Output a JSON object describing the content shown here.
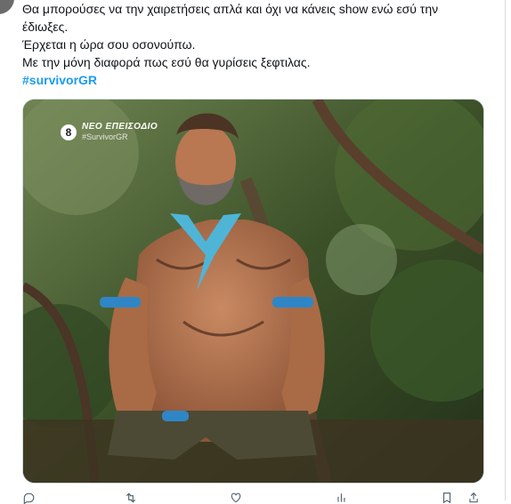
{
  "tweet": {
    "lines": [
      "Θα μπορούσες να την χαιρετήσεις απλά και όχι να κάνεις show ενώ εσύ την",
      "έδιωξες.",
      "Έρχεται η ώρα σου οσονούπω.",
      "Με την μόνη διαφορά πως εσύ θα γυρίσεις ξεφτιλας."
    ],
    "hashtag": "#survivorGR"
  },
  "media": {
    "channel_logo": "8",
    "overlay_title": "ΝΕΟ ΕΠΕΙΣΟΔΙΟ",
    "overlay_tag": "#SurvivorGR"
  },
  "actions": {
    "reply_icon": "reply-icon",
    "retweet_icon": "retweet-icon",
    "like_icon": "like-icon",
    "views_icon": "views-icon",
    "bookmark_icon": "bookmark-icon",
    "share_icon": "share-icon"
  },
  "colors": {
    "hashtag": "#1d9bf0",
    "text": "#0f1419",
    "muted": "#536471"
  }
}
